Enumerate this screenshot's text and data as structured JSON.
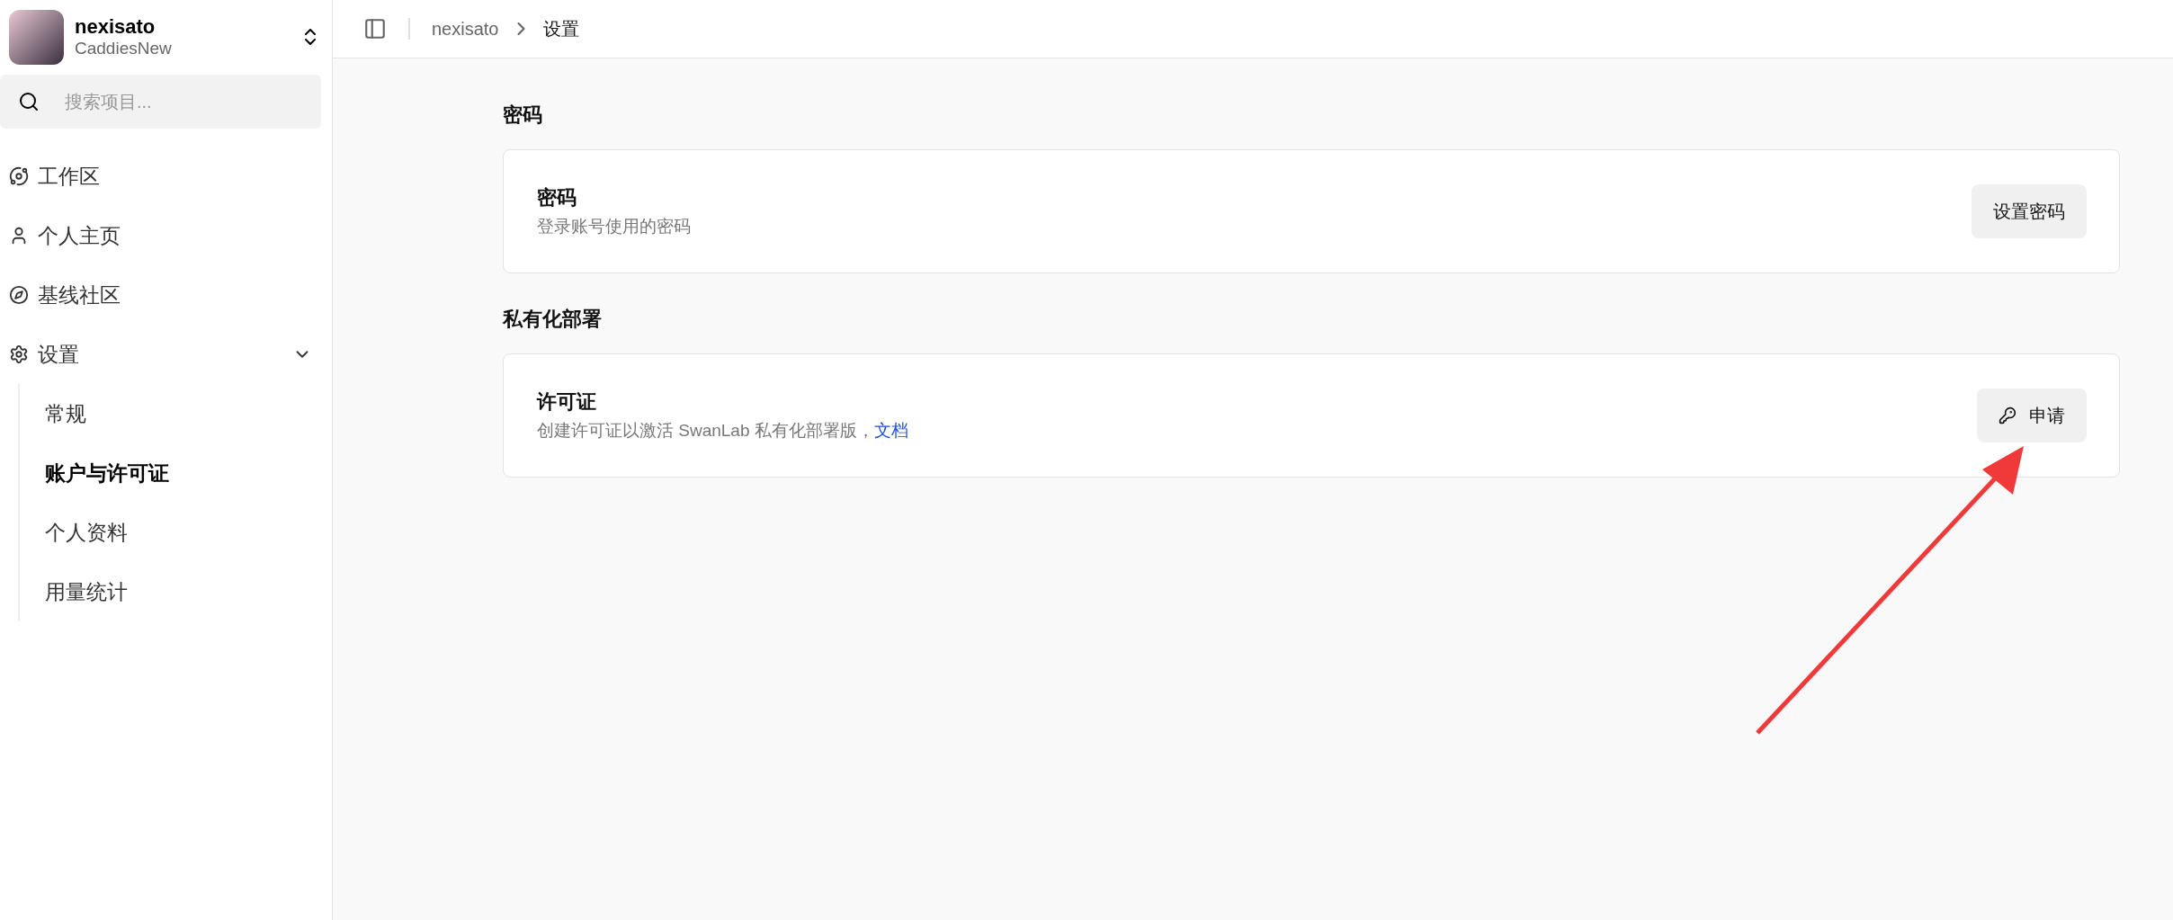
{
  "account": {
    "name": "nexisato",
    "team": "CaddiesNew"
  },
  "search": {
    "placeholder": "搜索项目..."
  },
  "sidebar": {
    "items": [
      {
        "label": "工作区",
        "selected": false
      },
      {
        "label": "个人主页",
        "selected": false
      },
      {
        "label": "基线社区",
        "selected": false
      },
      {
        "label": "设置",
        "selected": false,
        "expanded": true,
        "children": [
          {
            "label": "常规",
            "selected": false
          },
          {
            "label": "账户与许可证",
            "selected": true
          },
          {
            "label": "个人资料",
            "selected": false
          },
          {
            "label": "用量统计",
            "selected": false
          }
        ]
      }
    ]
  },
  "breadcrumb": [
    "nexisato",
    "设置"
  ],
  "sections": [
    {
      "title": "密码",
      "card": {
        "title": "密码",
        "description": "登录账号使用的密码",
        "button": {
          "label": "设置密码",
          "kind": "plain"
        }
      }
    },
    {
      "title": "私有化部署",
      "card": {
        "title": "许可证",
        "description": "创建许可证以激活 SwanLab 私有化部署版，",
        "link": "文档",
        "button": {
          "label": "申请",
          "kind": "key"
        }
      }
    }
  ]
}
